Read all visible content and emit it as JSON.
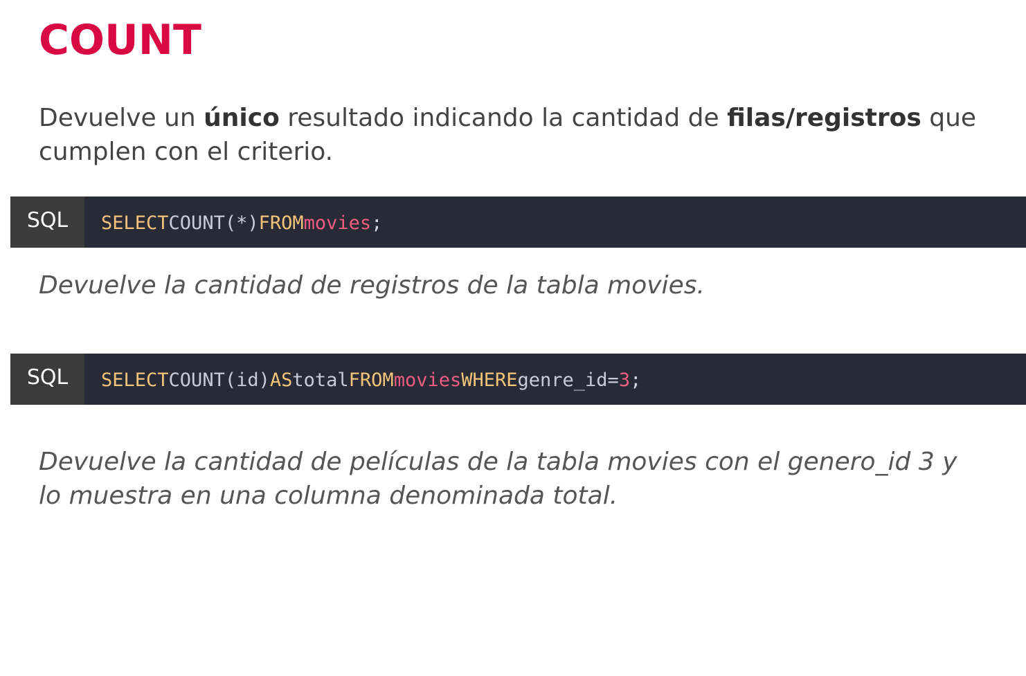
{
  "title": "COUNT",
  "intro": {
    "part1": "Devuelve un ",
    "bold1": "único",
    "part2": " resultado indicando la cantidad de ",
    "bold2": "filas/registros",
    "part3": " que cumplen con el criterio."
  },
  "examples": [
    {
      "lang": "SQL",
      "code": {
        "select": "SELECT",
        "func": "COUNT(*)",
        "from": "FROM",
        "table": "movies",
        "end": ";"
      },
      "caption": "Devuelve la cantidad de registros de la tabla movies."
    },
    {
      "lang": "SQL",
      "code": {
        "select": "SELECT",
        "func": "COUNT(id)",
        "as": "AS",
        "alias": "total",
        "from": "FROM",
        "table": "movies",
        "where": "WHERE",
        "cond_col": "genre_id=",
        "cond_val": "3",
        "end": ";"
      },
      "caption": "Devuelve la cantidad de películas de la tabla movies con el genero_id 3 y lo muestra en una columna denominada total."
    }
  ],
  "colors": {
    "title": "#d90a43",
    "code_background": "#282a36",
    "lang_tag_background": "#3b3b3b",
    "keyword": "#f3c47a",
    "table_name": "#ef5d82"
  }
}
